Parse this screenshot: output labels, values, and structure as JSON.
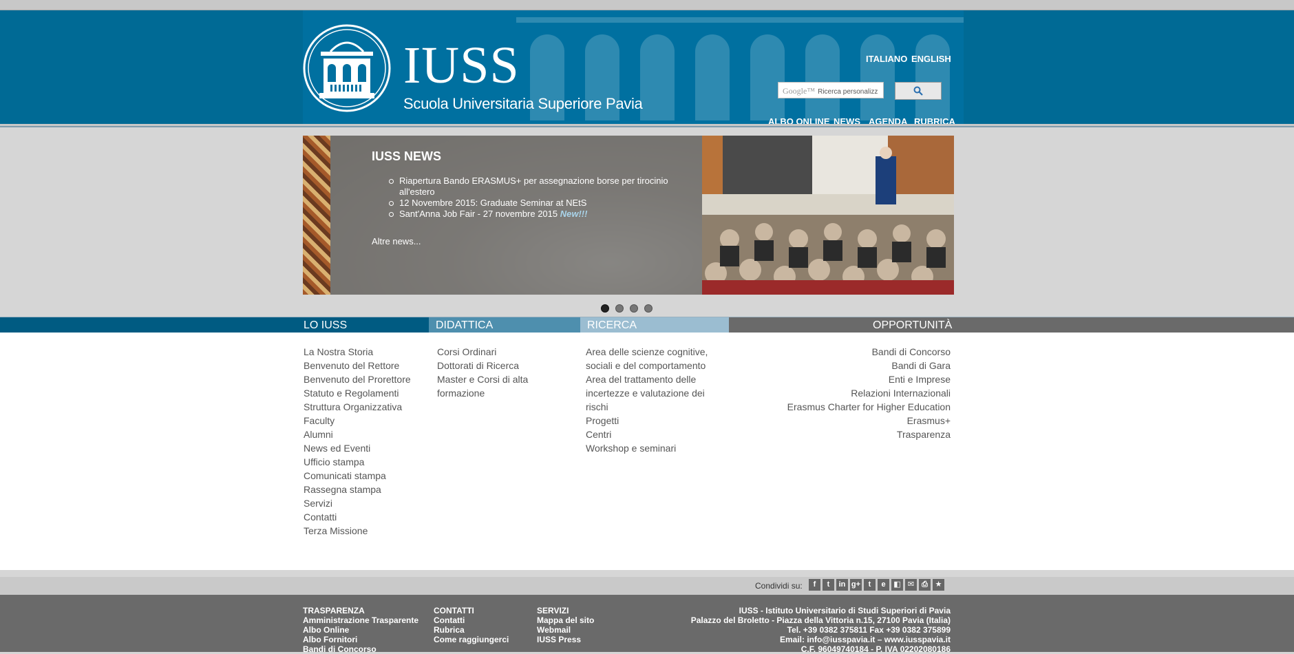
{
  "header": {
    "logo_name": "IUSS",
    "logo_subtitle": "Scuola Universitaria Superiore Pavia",
    "languages": [
      "ITALIANO",
      "ENGLISH"
    ],
    "search": {
      "brand": "Google™",
      "placeholder": "Ricerca personalizz"
    },
    "nav": [
      "ALBO ONLINE",
      "NEWS",
      "AGENDA",
      "RUBRICA"
    ]
  },
  "news": {
    "title": "IUSS NEWS",
    "items": [
      "Riapertura Bando ERASMUS+ per assegnazione borse per tirocinio all'estero",
      "12 Novembre 2015: Graduate Seminar at NEtS",
      "Sant'Anna Job Fair - 27 novembre 2015"
    ],
    "new_badge": "New!!!",
    "more": "Altre news..."
  },
  "slider": {
    "slide_count": 4,
    "active_index": 0
  },
  "colors": {
    "header_blue": "#0070a0",
    "lo_iuss": "#005b82",
    "didattica": "#4e8fae",
    "ricerca": "#9bbdd1",
    "opportunita": "#6a6a6a"
  },
  "menu": {
    "lo_iuss": {
      "title": "LO IUSS",
      "links": [
        "La Nostra Storia",
        "Benvenuto del Rettore",
        "Benvenuto del Prorettore",
        "Statuto e Regolamenti",
        "Struttura Organizzativa",
        "Faculty",
        "Alumni",
        "News ed Eventi",
        "Ufficio stampa",
        "Comunicati stampa",
        "Rassegna stampa",
        "Servizi",
        "Contatti",
        "Terza Missione"
      ]
    },
    "didattica": {
      "title": "DIDATTICA",
      "links": [
        "Corsi Ordinari",
        "Dottorati di Ricerca",
        "Master e Corsi di alta",
        "formazione"
      ]
    },
    "ricerca": {
      "title": "RICERCA",
      "links": [
        "Area delle scienze cognitive,",
        "sociali e del comportamento",
        "Area del trattamento delle",
        "incertezze e valutazione dei",
        "rischi",
        "Progetti",
        "Centri",
        "Workshop e seminari"
      ]
    },
    "opportunita": {
      "title": "OPPORTUNITÀ",
      "links": [
        "Bandi di Concorso",
        "Bandi di Gara",
        "Enti e Imprese",
        "Relazioni Internazionali",
        "Erasmus Charter for Higher Education",
        "Erasmus+",
        "Trasparenza"
      ]
    }
  },
  "share": {
    "label": "Condividi su:",
    "icons": [
      "facebook-icon",
      "twitter-icon",
      "linkedin-icon",
      "googleplus-icon",
      "tumblr-icon",
      "evernote-icon",
      "delicious-icon",
      "email-icon",
      "print-icon",
      "favorite-icon"
    ]
  },
  "footer": {
    "trasparenza": {
      "title": "TRASPARENZA",
      "links": [
        "Amministrazione Trasparente",
        "Albo Online",
        "Albo Fornitori",
        "Bandi di Concorso"
      ]
    },
    "contatti": {
      "title": "CONTATTI",
      "links": [
        "Contatti",
        "Rubrica",
        "Come raggiungerci"
      ]
    },
    "servizi": {
      "title": "SERVIZI",
      "links": [
        "Mappa del sito",
        "Webmail",
        "IUSS Press"
      ]
    },
    "info": [
      "IUSS - Istituto Universitario di Studi Superiori di Pavia",
      "Palazzo del Broletto - Piazza della Vittoria n.15, 27100 Pavia (Italia)",
      "Tel. +39 0382 375811 Fax +39 0382 375899",
      "Email: info@iusspavia.it – www.iusspavia.it",
      "C.F. 96049740184 - P. IVA 02202080186"
    ]
  }
}
